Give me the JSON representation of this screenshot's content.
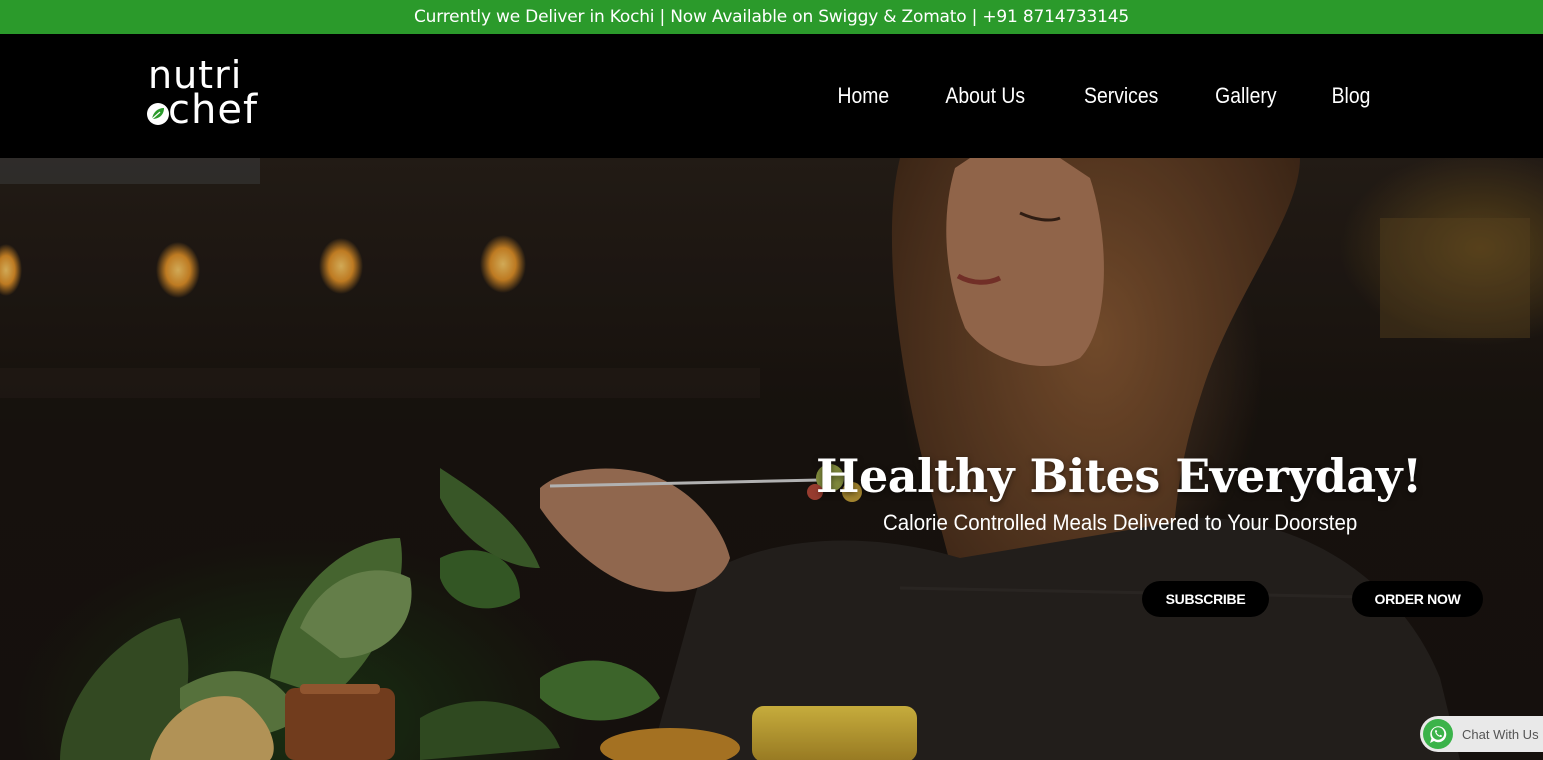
{
  "announcement": {
    "text": "Currently we Deliver in Kochi | Now Available on Swiggy & Zomato | +91 8714733145"
  },
  "brand": {
    "line1": "nutri",
    "line2": "chef",
    "accent_color": "#2b9a2b"
  },
  "nav": {
    "items": [
      {
        "label": "Home"
      },
      {
        "label": "About Us"
      },
      {
        "label": "Services"
      },
      {
        "label": "Gallery"
      },
      {
        "label": "Blog"
      }
    ]
  },
  "hero": {
    "title": "Healthy Bites Everyday!",
    "subtitle": "Calorie Controlled Meals Delivered to Your Doorstep",
    "buttons": {
      "subscribe": "SUBSCRIBE",
      "order": "ORDER NOW"
    }
  },
  "chat_widget": {
    "label": "Chat With Us",
    "icon": "whatsapp-icon"
  }
}
